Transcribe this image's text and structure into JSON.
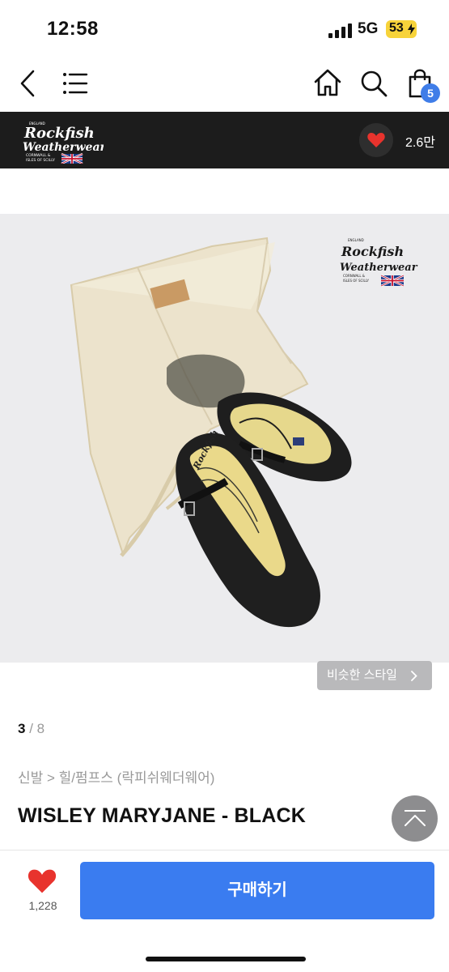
{
  "status_bar": {
    "time": "12:58",
    "network": "5G",
    "battery": "53"
  },
  "nav": {
    "back_icon": "chevron-left-icon",
    "menu_icon": "menu-icon",
    "home_icon": "home-icon",
    "search_icon": "search-icon",
    "cart_icon": "shopping-bag-icon",
    "cart_count": "5"
  },
  "brand": {
    "name_line1": "Rockfish",
    "name_line2": "Weatherwear",
    "tagline1": "CORNWALL &",
    "tagline2": "ISLES OF SCILLY",
    "likes": "2.6만"
  },
  "image_logo": {
    "line1": "Rockfish",
    "line2": "Weatherwear",
    "tag1": "CORNWALL &",
    "tag2": "ISLES OF SCILLY"
  },
  "similar_style": "비슷한 스타일",
  "pager": {
    "current": "3",
    "separator": " / ",
    "total": "8"
  },
  "breadcrumb": "신발 > 힐/펌프스 (락피쉬웨더웨어)",
  "product": {
    "title": "WISLEY MARYJANE - BLACK"
  },
  "bottom": {
    "wish_count": "1,228",
    "buy_label": "구매하기"
  },
  "colors": {
    "accent": "#3a7cf0",
    "heart": "#e8332d",
    "brand_bar": "#1c1c1c"
  }
}
